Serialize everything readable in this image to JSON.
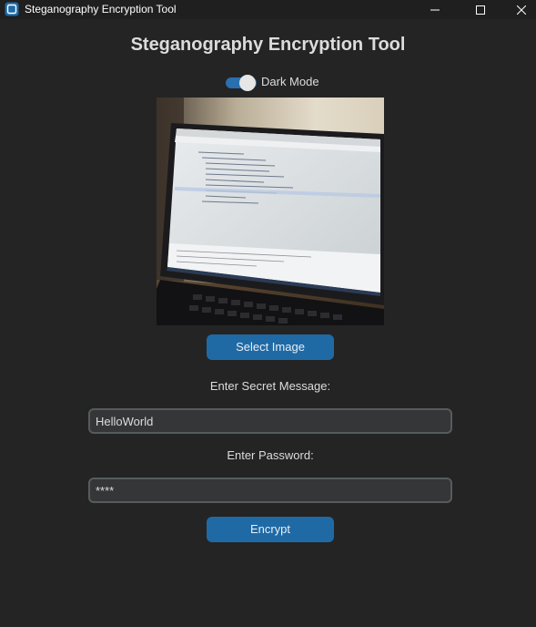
{
  "window": {
    "title": "Steganography Encryption Tool",
    "icon": "app-icon",
    "controls": [
      "minimize-icon",
      "maximize-icon",
      "close-icon"
    ]
  },
  "main": {
    "heading": "Steganography Encryption Tool",
    "theme_toggle": {
      "label": "Dark Mode",
      "checked": true
    },
    "preview_image": "laptop-code-photo",
    "select_button_label": "Select Image",
    "message_label": "Enter Secret Message:",
    "message_value": "HelloWorld",
    "password_label": "Enter Password:",
    "password_value": "****",
    "encrypt_button_label": "Encrypt"
  },
  "colors": {
    "background": "#242424",
    "titlebar": "#1f1f1f",
    "accent": "#1f6aa5",
    "field_bg": "#343638",
    "field_border": "#565b5e",
    "text": "#dcdcdc"
  }
}
